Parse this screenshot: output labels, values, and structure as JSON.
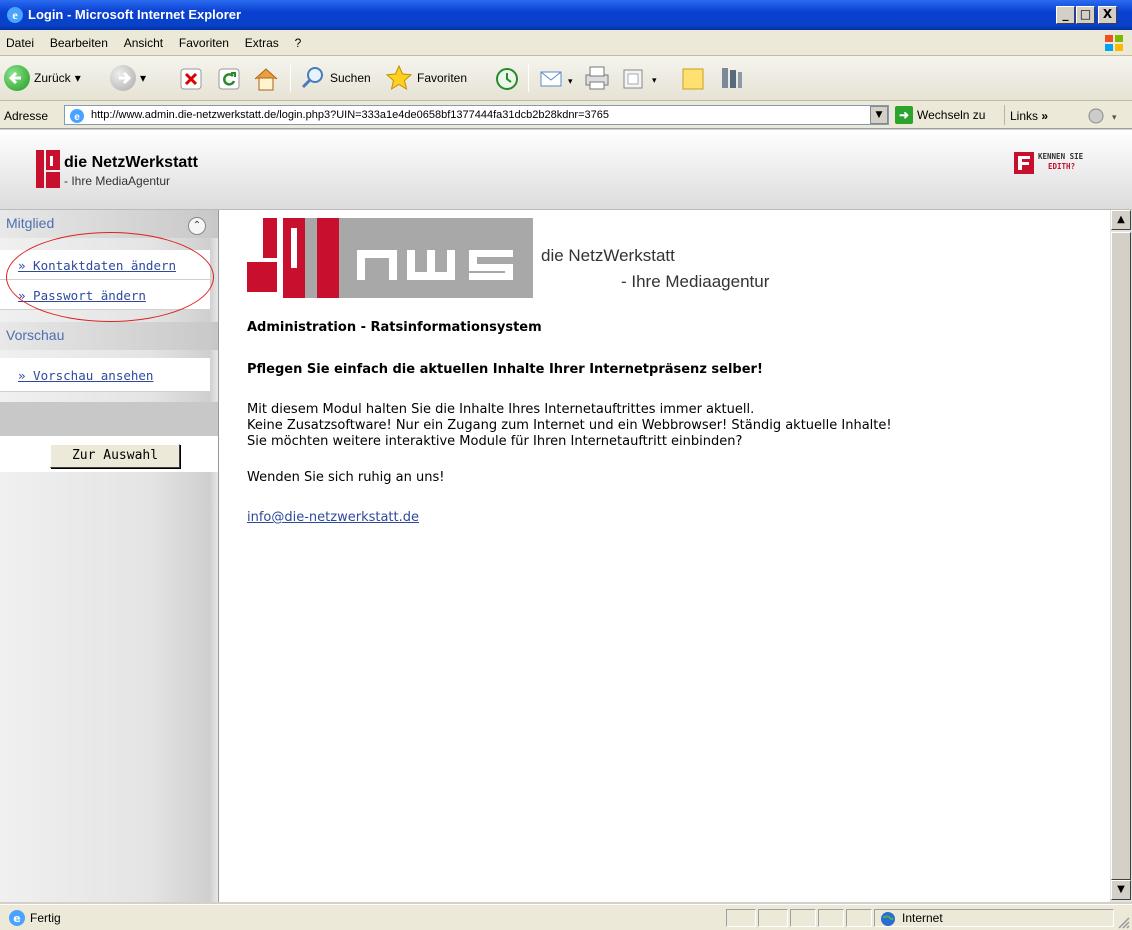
{
  "window": {
    "title": "Login - Microsoft Internet Explorer",
    "min": "_",
    "max": "□",
    "close": "X"
  },
  "menu": [
    "Datei",
    "Bearbeiten",
    "Ansicht",
    "Favoriten",
    "Extras",
    "?"
  ],
  "toolbar": {
    "back": "Zurück",
    "search": "Suchen",
    "favorites": "Favoriten"
  },
  "address": {
    "label": "Adresse",
    "url": "http://www.admin.die-netzwerkstatt.de/login.php3?UIN=333a1e4de0658bf1377444fa31dcb2b28kdnr=3765",
    "go": "Wechseln zu",
    "links": "Links"
  },
  "header": {
    "name": "die NetzWerkstatt",
    "sub": "- Ihre MediaAgentur",
    "right_line1": "KENNEN SIE",
    "right_line2": "EDITH?"
  },
  "sidebar": {
    "section1": "Mitglied",
    "items1": [
      "» Kontaktdaten ändern",
      "» Passwort ändern"
    ],
    "section2": "Vorschau",
    "items2": [
      "» Vorschau ansehen"
    ],
    "button": "Zur Auswahl"
  },
  "content": {
    "logo_text": "nws",
    "tagline1": "die NetzWerkstatt",
    "tagline2": "- Ihre Mediaagentur",
    "heading": "Administration - Ratsinformationsystem",
    "subheading": "Pflegen Sie einfach die aktuellen Inhalte Ihrer Internetpräsenz selber!",
    "para1": "Mit diesem Modul halten Sie die Inhalte Ihres Internetauftrittes immer aktuell.",
    "para2": "Keine Zusatzsoftware! Nur ein Zugang zum Internet und ein Webbrowser! Ständig aktuelle Inhalte!",
    "para3": "Sie möchten weitere interaktive Module für Ihren Internetauftritt einbinden?",
    "para4": "Wenden Sie sich ruhig an uns!",
    "email": "info@die-netzwerkstatt.de"
  },
  "status": {
    "text": "Fertig",
    "zone": "Internet"
  }
}
